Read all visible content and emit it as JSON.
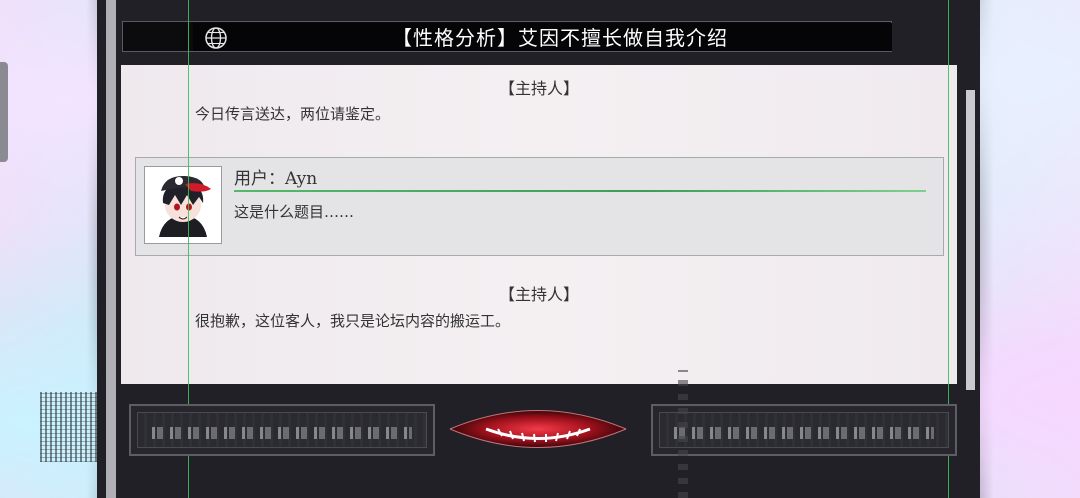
{
  "header": {
    "title": "【性格分析】艾因不擅长做自我介绍",
    "icon": "globe-icon"
  },
  "messages": [
    {
      "speaker": "【主持人】",
      "text": "今日传言送达，两位请鉴定。"
    },
    {
      "speaker": "【主持人】",
      "text": "很抱歉，这位客人，我只是论坛内容的搬运工。"
    }
  ],
  "user_card": {
    "name": "用户：Ayn",
    "text": "这是什么题目……",
    "avatar": "avatar-portrait"
  },
  "colors": {
    "accent_green": "#3bbf5a",
    "accent_red": "#d11a2a",
    "panel": "#202026"
  }
}
